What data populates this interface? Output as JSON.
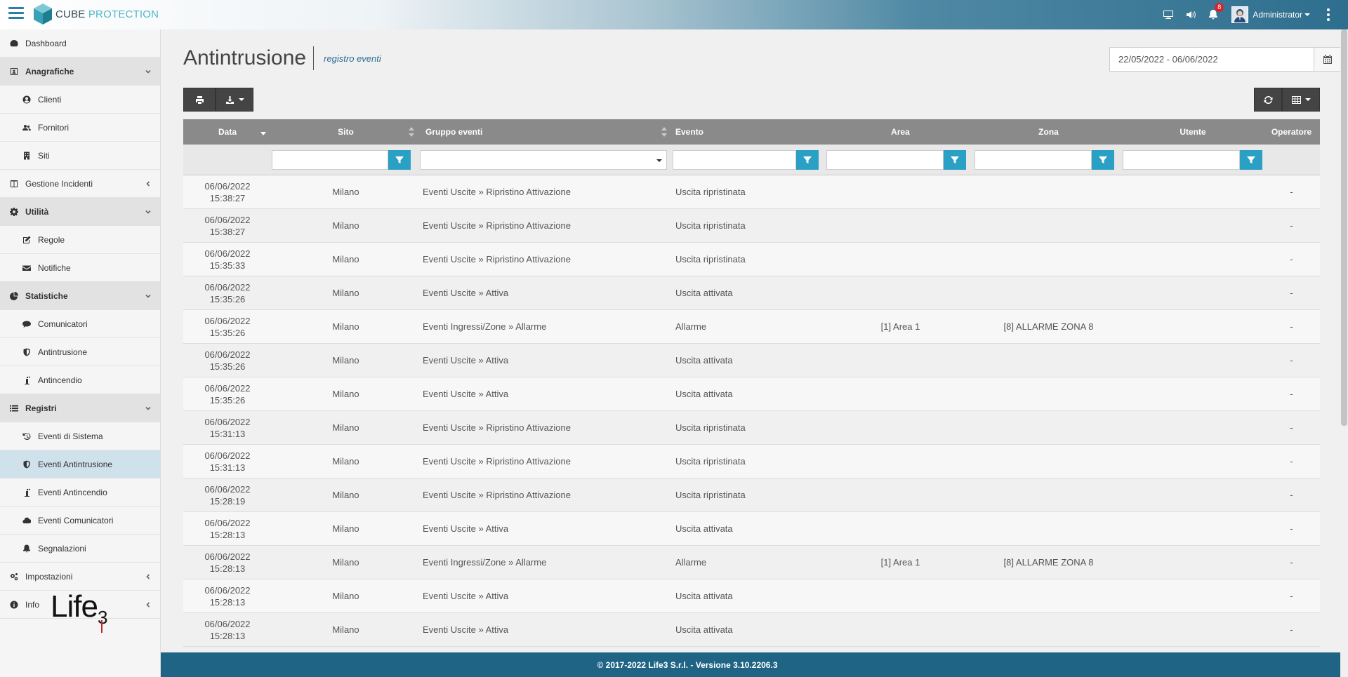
{
  "app": {
    "brand_main": "CUBE",
    "brand_sub": " PROTECTION",
    "notifications_count": "8",
    "user_name": "Administrator"
  },
  "sidebar": {
    "items": [
      {
        "label": "Dashboard",
        "icon": "dashboard-icon"
      },
      {
        "label": "Anagrafiche",
        "icon": "address-card-icon"
      },
      {
        "label": "Clienti",
        "icon": "user-circle-icon"
      },
      {
        "label": "Fornitori",
        "icon": "users-icon"
      },
      {
        "label": "Siti",
        "icon": "building-icon"
      },
      {
        "label": "Gestione Incidenti",
        "icon": "columns-icon"
      },
      {
        "label": "Utilità",
        "icon": "gear-icon"
      },
      {
        "label": "Regole",
        "icon": "edit-icon"
      },
      {
        "label": "Notifiche",
        "icon": "envelope-icon"
      },
      {
        "label": "Statistiche",
        "icon": "pie-chart-icon"
      },
      {
        "label": "Comunicatori",
        "icon": "comment-icon"
      },
      {
        "label": "Antintrusione",
        "icon": "shield-icon"
      },
      {
        "label": "Antincendio",
        "icon": "extinguisher-icon"
      },
      {
        "label": "Registri",
        "icon": "list-icon"
      },
      {
        "label": "Eventi di Sistema",
        "icon": "history-icon"
      },
      {
        "label": "Eventi Antintrusione",
        "icon": "shield-icon"
      },
      {
        "label": "Eventi Antincendio",
        "icon": "extinguisher-icon"
      },
      {
        "label": "Eventi Comunicatori",
        "icon": "cloud-icon"
      },
      {
        "label": "Segnalazioni",
        "icon": "bell-icon"
      },
      {
        "label": "Impostazioni",
        "icon": "gears-icon"
      },
      {
        "label": "Info",
        "icon": "info-circle-icon"
      }
    ],
    "brand_logo_text": "Life3"
  },
  "header": {
    "title": "Antintrusione",
    "subtitle": "registro eventi",
    "date_range": "22/05/2022 - 06/06/2022"
  },
  "table": {
    "columns": [
      "Data",
      "Sito",
      "Gruppo eventi",
      "Evento",
      "Area",
      "Zona",
      "Utente",
      "Operatore"
    ],
    "rows": [
      {
        "date": "06/06/2022",
        "time": "15:38:27",
        "sito": "Milano",
        "gruppo": "Eventi Uscite » Ripristino Attivazione",
        "evento": "Uscita ripristinata",
        "area": "",
        "zona": "",
        "utente": "",
        "operatore": "-"
      },
      {
        "date": "06/06/2022",
        "time": "15:38:27",
        "sito": "Milano",
        "gruppo": "Eventi Uscite » Ripristino Attivazione",
        "evento": "Uscita ripristinata",
        "area": "",
        "zona": "",
        "utente": "",
        "operatore": "-"
      },
      {
        "date": "06/06/2022",
        "time": "15:35:33",
        "sito": "Milano",
        "gruppo": "Eventi Uscite » Ripristino Attivazione",
        "evento": "Uscita ripristinata",
        "area": "",
        "zona": "",
        "utente": "",
        "operatore": "-"
      },
      {
        "date": "06/06/2022",
        "time": "15:35:26",
        "sito": "Milano",
        "gruppo": "Eventi Uscite » Attiva",
        "evento": "Uscita attivata",
        "area": "",
        "zona": "",
        "utente": "",
        "operatore": "-"
      },
      {
        "date": "06/06/2022",
        "time": "15:35:26",
        "sito": "Milano",
        "gruppo": "Eventi Ingressi/Zone » Allarme",
        "evento": "Allarme",
        "area": "[1] Area 1",
        "zona": "[8] ALLARME ZONA 8",
        "utente": "",
        "operatore": "-"
      },
      {
        "date": "06/06/2022",
        "time": "15:35:26",
        "sito": "Milano",
        "gruppo": "Eventi Uscite » Attiva",
        "evento": "Uscita attivata",
        "area": "",
        "zona": "",
        "utente": "",
        "operatore": "-"
      },
      {
        "date": "06/06/2022",
        "time": "15:35:26",
        "sito": "Milano",
        "gruppo": "Eventi Uscite » Attiva",
        "evento": "Uscita attivata",
        "area": "",
        "zona": "",
        "utente": "",
        "operatore": "-"
      },
      {
        "date": "06/06/2022",
        "time": "15:31:13",
        "sito": "Milano",
        "gruppo": "Eventi Uscite » Ripristino Attivazione",
        "evento": "Uscita ripristinata",
        "area": "",
        "zona": "",
        "utente": "",
        "operatore": "-"
      },
      {
        "date": "06/06/2022",
        "time": "15:31:13",
        "sito": "Milano",
        "gruppo": "Eventi Uscite » Ripristino Attivazione",
        "evento": "Uscita ripristinata",
        "area": "",
        "zona": "",
        "utente": "",
        "operatore": "-"
      },
      {
        "date": "06/06/2022",
        "time": "15:28:19",
        "sito": "Milano",
        "gruppo": "Eventi Uscite » Ripristino Attivazione",
        "evento": "Uscita ripristinata",
        "area": "",
        "zona": "",
        "utente": "",
        "operatore": "-"
      },
      {
        "date": "06/06/2022",
        "time": "15:28:13",
        "sito": "Milano",
        "gruppo": "Eventi Uscite » Attiva",
        "evento": "Uscita attivata",
        "area": "",
        "zona": "",
        "utente": "",
        "operatore": "-"
      },
      {
        "date": "06/06/2022",
        "time": "15:28:13",
        "sito": "Milano",
        "gruppo": "Eventi Ingressi/Zone » Allarme",
        "evento": "Allarme",
        "area": "[1] Area 1",
        "zona": "[8] ALLARME ZONA 8",
        "utente": "",
        "operatore": "-"
      },
      {
        "date": "06/06/2022",
        "time": "15:28:13",
        "sito": "Milano",
        "gruppo": "Eventi Uscite » Attiva",
        "evento": "Uscita attivata",
        "area": "",
        "zona": "",
        "utente": "",
        "operatore": "-"
      },
      {
        "date": "06/06/2022",
        "time": "15:28:13",
        "sito": "Milano",
        "gruppo": "Eventi Uscite » Attiva",
        "evento": "Uscita attivata",
        "area": "",
        "zona": "",
        "utente": "",
        "operatore": "-"
      }
    ]
  },
  "footer": {
    "text": "© 2017-2022 Life3 S.r.l. - Versione 3.10.2206.3"
  },
  "colors": {
    "accent": "#2aa0c4",
    "footer": "#1f6485",
    "header_row": "#8a8a8a"
  }
}
